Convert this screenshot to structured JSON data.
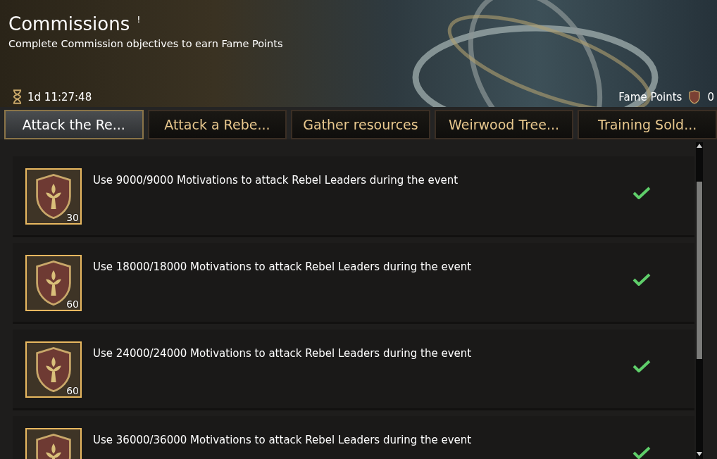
{
  "header": {
    "title": "Commissions",
    "info_mark": "!",
    "subtitle": "Complete Commission objectives to earn Fame Points",
    "timer": "1d 11:27:48",
    "fame_label": "Fame Points",
    "fame_value": "0"
  },
  "tabs": [
    {
      "label": "Attack the Re...",
      "selected": true
    },
    {
      "label": "Attack a Rebe...",
      "selected": false
    },
    {
      "label": "Gather resources",
      "selected": false
    },
    {
      "label": "Weirwood Tree...",
      "selected": false
    },
    {
      "label": "Training Sold...",
      "selected": false
    }
  ],
  "objectives": [
    {
      "text": "Use 9000/9000 Motivations to attack Rebel Leaders during the event",
      "reward_count": "30",
      "completed": true
    },
    {
      "text": "Use 18000/18000 Motivations to attack Rebel Leaders during the event",
      "reward_count": "60",
      "completed": true
    },
    {
      "text": "Use 24000/24000 Motivations to attack Rebel Leaders during the event",
      "reward_count": "60",
      "completed": true
    },
    {
      "text": "Use 36000/36000 Motivations to attack Rebel Leaders during the event",
      "completed": true
    }
  ]
}
